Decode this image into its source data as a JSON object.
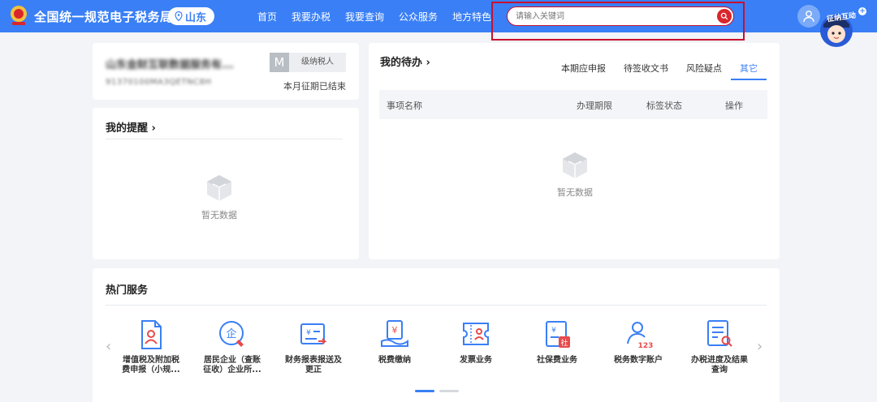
{
  "header": {
    "site_title": "全国统一规范电子税务局",
    "region": "山东",
    "nav": [
      "首页",
      "我要办税",
      "我要查询",
      "公众服务",
      "地方特色"
    ],
    "search_placeholder": "请输入关键词",
    "mascot_label": "征纳互动",
    "brand_color": "#3a7ff5",
    "highlight_color": "#c8102e"
  },
  "company": {
    "name": "山东金财互联数据服务有...",
    "tax_id": "91370100MA3QETNC8H",
    "taxpayer_grade": "M",
    "taxpayer_type": "级纳税人",
    "period_status": "本月征期已结束"
  },
  "reminders": {
    "title": "我的提醒 ›",
    "empty_text": "暂无数据"
  },
  "todo": {
    "title": "我的待办 ›",
    "tabs": [
      "本期应申报",
      "待签收文书",
      "风险疑点",
      "其它"
    ],
    "active_tab": "其它",
    "columns": [
      "事项名称",
      "办理期限",
      "标签状态",
      "操作"
    ],
    "empty_text": "暂无数据"
  },
  "hot_services": {
    "title": "热门服务",
    "items": [
      {
        "label": "增值税及附加税\n费申报（小规...",
        "icon": "user-document-icon"
      },
      {
        "label": "居民企业（查账\n征收）企业所...",
        "icon": "enterprise-seal-icon"
      },
      {
        "label": "财务报表报送及\n更正",
        "icon": "finance-report-icon"
      },
      {
        "label": "税费缴纳",
        "icon": "payment-icon"
      },
      {
        "label": "发票业务",
        "icon": "invoice-icon"
      },
      {
        "label": "社保费业务",
        "icon": "social-insurance-icon"
      },
      {
        "label": "税务数字账户",
        "icon": "digital-account-icon"
      },
      {
        "label": "办税进度及结果\n查询",
        "icon": "progress-query-icon"
      }
    ]
  }
}
